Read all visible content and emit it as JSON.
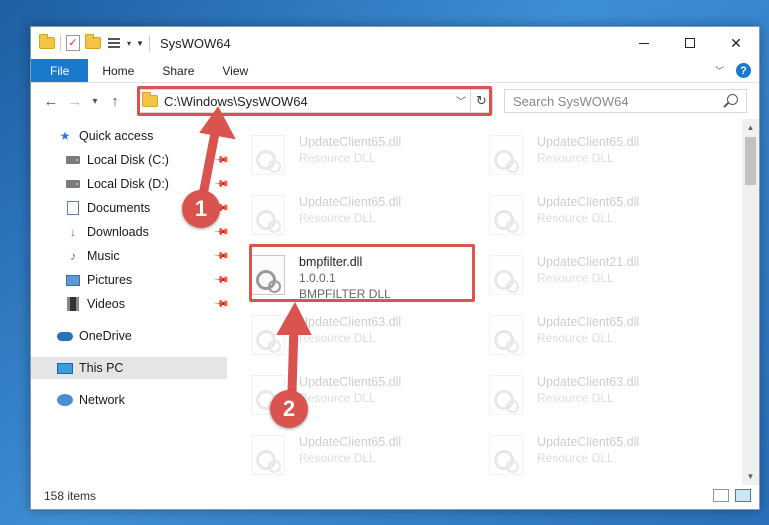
{
  "window": {
    "title": "SysWOW64",
    "controls": {
      "minimize": "minimize",
      "maximize": "maximize",
      "close": "✕"
    }
  },
  "ribbon": {
    "tabs": [
      "File",
      "Home",
      "Share",
      "View"
    ],
    "help": "?"
  },
  "address": {
    "path": "C:\\Windows\\SysWOW64",
    "search_placeholder": "Search SysWOW64"
  },
  "sidebar": {
    "items": [
      {
        "label": "Quick access",
        "icon": "star-icon"
      },
      {
        "label": "Local Disk (C:)",
        "icon": "drive-icon",
        "pinned": true
      },
      {
        "label": "Local Disk (D:)",
        "icon": "drive-icon",
        "pinned": true
      },
      {
        "label": "Documents",
        "icon": "documents-icon",
        "pinned": true
      },
      {
        "label": "Downloads",
        "icon": "downloads-icon",
        "pinned": true
      },
      {
        "label": "Music",
        "icon": "music-icon",
        "pinned": true
      },
      {
        "label": "Pictures",
        "icon": "pictures-icon",
        "pinned": true
      },
      {
        "label": "Videos",
        "icon": "videos-icon",
        "pinned": true
      },
      {
        "label": "OneDrive",
        "icon": "onedrive-icon"
      },
      {
        "label": "This PC",
        "icon": "this-pc-icon",
        "selected": true
      },
      {
        "label": "Network",
        "icon": "network-icon"
      }
    ]
  },
  "files": [
    {
      "name": "UpdateClient65.dll",
      "line2": "Resource DLL"
    },
    {
      "name": "UpdateClient65.dll",
      "line2": "Resource DLL"
    },
    {
      "name": "UpdateClient65.dll",
      "line2": "Resource DLL"
    },
    {
      "name": "UpdateClient65.dll",
      "line2": "Resource DLL"
    },
    {
      "name": "bmpfilter.dll",
      "line2": "1.0.0.1",
      "line3": "BMPFILTER DLL",
      "highlighted": true
    },
    {
      "name": "UpdateClient21.dll",
      "line2": "Resource DLL"
    },
    {
      "name": "UpdateClient63.dll",
      "line2": "Resource DLL"
    },
    {
      "name": "UpdateClient65.dll",
      "line2": "Resource DLL"
    },
    {
      "name": "UpdateClient65.dll",
      "line2": "Resource DLL"
    },
    {
      "name": "UpdateClient63.dll",
      "line2": "Resource DLL"
    },
    {
      "name": "UpdateClient65.dll",
      "line2": "Resource DLL"
    },
    {
      "name": "UpdateClient65.dll",
      "line2": "Resource DLL"
    }
  ],
  "status": {
    "item_count": "158 items"
  },
  "annotations": {
    "step1": "1",
    "step2": "2"
  },
  "colors": {
    "accent": "#1979ca",
    "highlight": "#d9534f"
  }
}
